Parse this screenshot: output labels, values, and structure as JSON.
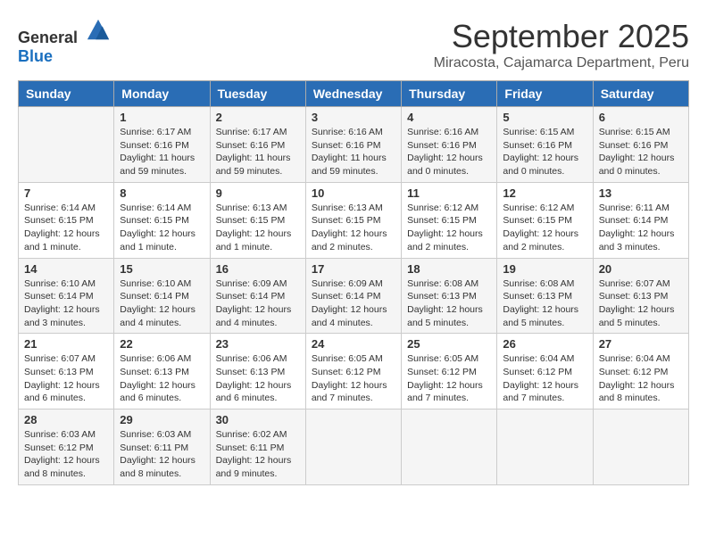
{
  "header": {
    "logo_general": "General",
    "logo_blue": "Blue",
    "month": "September 2025",
    "location": "Miracosta, Cajamarca Department, Peru"
  },
  "days_of_week": [
    "Sunday",
    "Monday",
    "Tuesday",
    "Wednesday",
    "Thursday",
    "Friday",
    "Saturday"
  ],
  "weeks": [
    [
      {
        "day": "",
        "sunrise": "",
        "sunset": "",
        "daylight": ""
      },
      {
        "day": "1",
        "sunrise": "Sunrise: 6:17 AM",
        "sunset": "Sunset: 6:16 PM",
        "daylight": "Daylight: 11 hours and 59 minutes."
      },
      {
        "day": "2",
        "sunrise": "Sunrise: 6:17 AM",
        "sunset": "Sunset: 6:16 PM",
        "daylight": "Daylight: 11 hours and 59 minutes."
      },
      {
        "day": "3",
        "sunrise": "Sunrise: 6:16 AM",
        "sunset": "Sunset: 6:16 PM",
        "daylight": "Daylight: 11 hours and 59 minutes."
      },
      {
        "day": "4",
        "sunrise": "Sunrise: 6:16 AM",
        "sunset": "Sunset: 6:16 PM",
        "daylight": "Daylight: 12 hours and 0 minutes."
      },
      {
        "day": "5",
        "sunrise": "Sunrise: 6:15 AM",
        "sunset": "Sunset: 6:16 PM",
        "daylight": "Daylight: 12 hours and 0 minutes."
      },
      {
        "day": "6",
        "sunrise": "Sunrise: 6:15 AM",
        "sunset": "Sunset: 6:16 PM",
        "daylight": "Daylight: 12 hours and 0 minutes."
      }
    ],
    [
      {
        "day": "7",
        "sunrise": "Sunrise: 6:14 AM",
        "sunset": "Sunset: 6:15 PM",
        "daylight": "Daylight: 12 hours and 1 minute."
      },
      {
        "day": "8",
        "sunrise": "Sunrise: 6:14 AM",
        "sunset": "Sunset: 6:15 PM",
        "daylight": "Daylight: 12 hours and 1 minute."
      },
      {
        "day": "9",
        "sunrise": "Sunrise: 6:13 AM",
        "sunset": "Sunset: 6:15 PM",
        "daylight": "Daylight: 12 hours and 1 minute."
      },
      {
        "day": "10",
        "sunrise": "Sunrise: 6:13 AM",
        "sunset": "Sunset: 6:15 PM",
        "daylight": "Daylight: 12 hours and 2 minutes."
      },
      {
        "day": "11",
        "sunrise": "Sunrise: 6:12 AM",
        "sunset": "Sunset: 6:15 PM",
        "daylight": "Daylight: 12 hours and 2 minutes."
      },
      {
        "day": "12",
        "sunrise": "Sunrise: 6:12 AM",
        "sunset": "Sunset: 6:15 PM",
        "daylight": "Daylight: 12 hours and 2 minutes."
      },
      {
        "day": "13",
        "sunrise": "Sunrise: 6:11 AM",
        "sunset": "Sunset: 6:14 PM",
        "daylight": "Daylight: 12 hours and 3 minutes."
      }
    ],
    [
      {
        "day": "14",
        "sunrise": "Sunrise: 6:10 AM",
        "sunset": "Sunset: 6:14 PM",
        "daylight": "Daylight: 12 hours and 3 minutes."
      },
      {
        "day": "15",
        "sunrise": "Sunrise: 6:10 AM",
        "sunset": "Sunset: 6:14 PM",
        "daylight": "Daylight: 12 hours and 4 minutes."
      },
      {
        "day": "16",
        "sunrise": "Sunrise: 6:09 AM",
        "sunset": "Sunset: 6:14 PM",
        "daylight": "Daylight: 12 hours and 4 minutes."
      },
      {
        "day": "17",
        "sunrise": "Sunrise: 6:09 AM",
        "sunset": "Sunset: 6:14 PM",
        "daylight": "Daylight: 12 hours and 4 minutes."
      },
      {
        "day": "18",
        "sunrise": "Sunrise: 6:08 AM",
        "sunset": "Sunset: 6:13 PM",
        "daylight": "Daylight: 12 hours and 5 minutes."
      },
      {
        "day": "19",
        "sunrise": "Sunrise: 6:08 AM",
        "sunset": "Sunset: 6:13 PM",
        "daylight": "Daylight: 12 hours and 5 minutes."
      },
      {
        "day": "20",
        "sunrise": "Sunrise: 6:07 AM",
        "sunset": "Sunset: 6:13 PM",
        "daylight": "Daylight: 12 hours and 5 minutes."
      }
    ],
    [
      {
        "day": "21",
        "sunrise": "Sunrise: 6:07 AM",
        "sunset": "Sunset: 6:13 PM",
        "daylight": "Daylight: 12 hours and 6 minutes."
      },
      {
        "day": "22",
        "sunrise": "Sunrise: 6:06 AM",
        "sunset": "Sunset: 6:13 PM",
        "daylight": "Daylight: 12 hours and 6 minutes."
      },
      {
        "day": "23",
        "sunrise": "Sunrise: 6:06 AM",
        "sunset": "Sunset: 6:13 PM",
        "daylight": "Daylight: 12 hours and 6 minutes."
      },
      {
        "day": "24",
        "sunrise": "Sunrise: 6:05 AM",
        "sunset": "Sunset: 6:12 PM",
        "daylight": "Daylight: 12 hours and 7 minutes."
      },
      {
        "day": "25",
        "sunrise": "Sunrise: 6:05 AM",
        "sunset": "Sunset: 6:12 PM",
        "daylight": "Daylight: 12 hours and 7 minutes."
      },
      {
        "day": "26",
        "sunrise": "Sunrise: 6:04 AM",
        "sunset": "Sunset: 6:12 PM",
        "daylight": "Daylight: 12 hours and 7 minutes."
      },
      {
        "day": "27",
        "sunrise": "Sunrise: 6:04 AM",
        "sunset": "Sunset: 6:12 PM",
        "daylight": "Daylight: 12 hours and 8 minutes."
      }
    ],
    [
      {
        "day": "28",
        "sunrise": "Sunrise: 6:03 AM",
        "sunset": "Sunset: 6:12 PM",
        "daylight": "Daylight: 12 hours and 8 minutes."
      },
      {
        "day": "29",
        "sunrise": "Sunrise: 6:03 AM",
        "sunset": "Sunset: 6:11 PM",
        "daylight": "Daylight: 12 hours and 8 minutes."
      },
      {
        "day": "30",
        "sunrise": "Sunrise: 6:02 AM",
        "sunset": "Sunset: 6:11 PM",
        "daylight": "Daylight: 12 hours and 9 minutes."
      },
      {
        "day": "",
        "sunrise": "",
        "sunset": "",
        "daylight": ""
      },
      {
        "day": "",
        "sunrise": "",
        "sunset": "",
        "daylight": ""
      },
      {
        "day": "",
        "sunrise": "",
        "sunset": "",
        "daylight": ""
      },
      {
        "day": "",
        "sunrise": "",
        "sunset": "",
        "daylight": ""
      }
    ]
  ]
}
